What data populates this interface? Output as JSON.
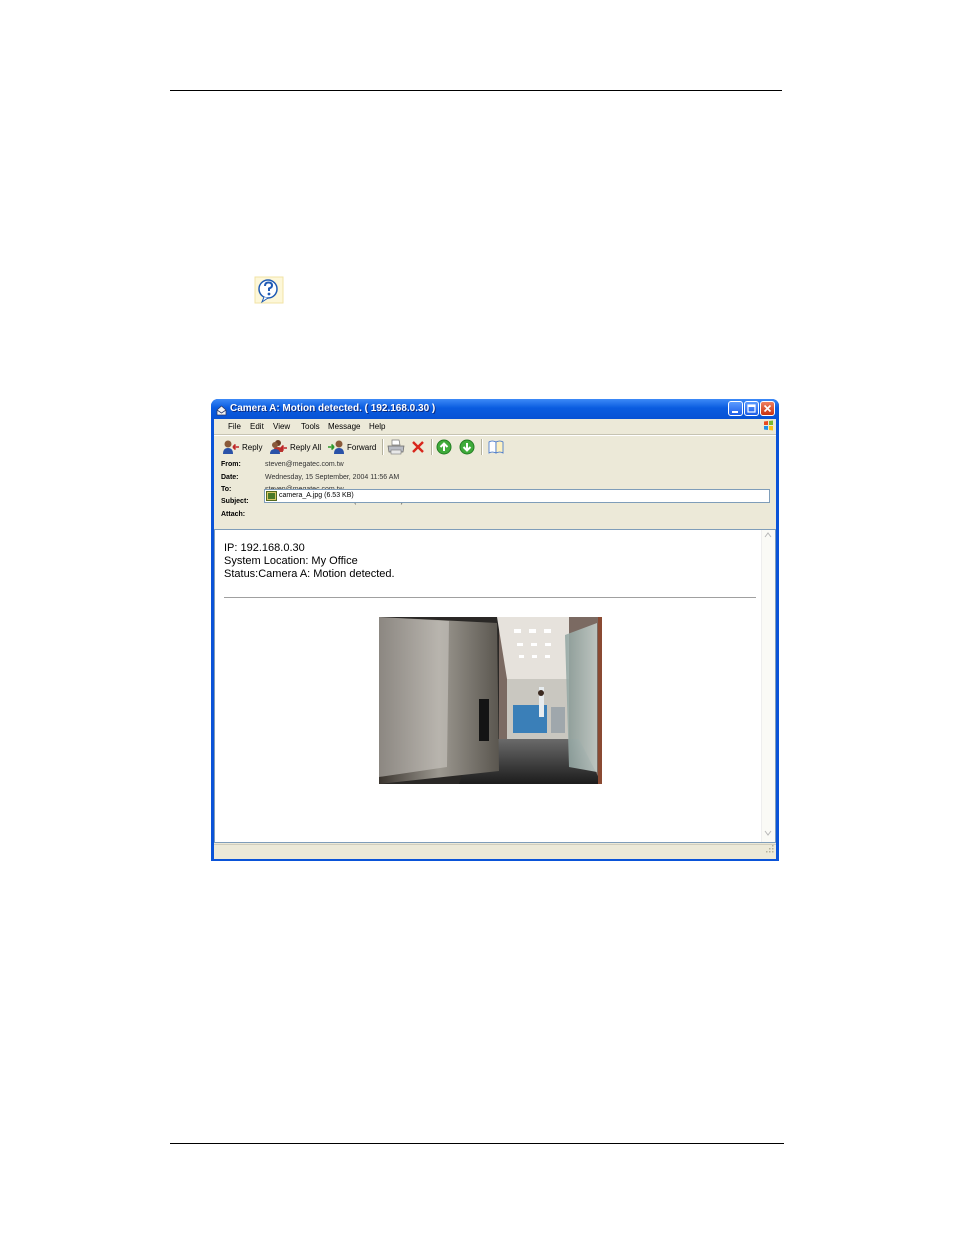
{
  "window": {
    "title": "Camera A: Motion detected. ( 192.168.0.30 )"
  },
  "menu": {
    "items": [
      "File",
      "Edit",
      "View",
      "Tools",
      "Message",
      "Help"
    ]
  },
  "toolbar": {
    "reply": "Reply",
    "reply_all": "Reply All",
    "forward": "Forward",
    "icons": [
      "print-icon",
      "delete-icon",
      "previous-icon",
      "next-icon",
      "addresses-icon"
    ]
  },
  "header": {
    "from_label": "From:",
    "from": "steven@megatec.com.tw",
    "date_label": "Date:",
    "date": "Wednesday, 15 September, 2004 11:56 AM",
    "to_label": "To:",
    "to": "steven@megatec.com.tw",
    "subject_label": "Subject:",
    "subject": "Camera A: Motion detected. ( 192.168.0.30 )",
    "attach_label": "Attach:",
    "attachment": "camera_A.jpg (6.53 KB)"
  },
  "message": {
    "ip_line": "IP: 192.168.0.30",
    "location_line": "System Location: My Office",
    "status_line": "Status:Camera A: Motion detected."
  },
  "colors": {
    "titlebar": "#0a5ce0",
    "client_bg": "#ece9d8",
    "close_button": "#c83210"
  }
}
